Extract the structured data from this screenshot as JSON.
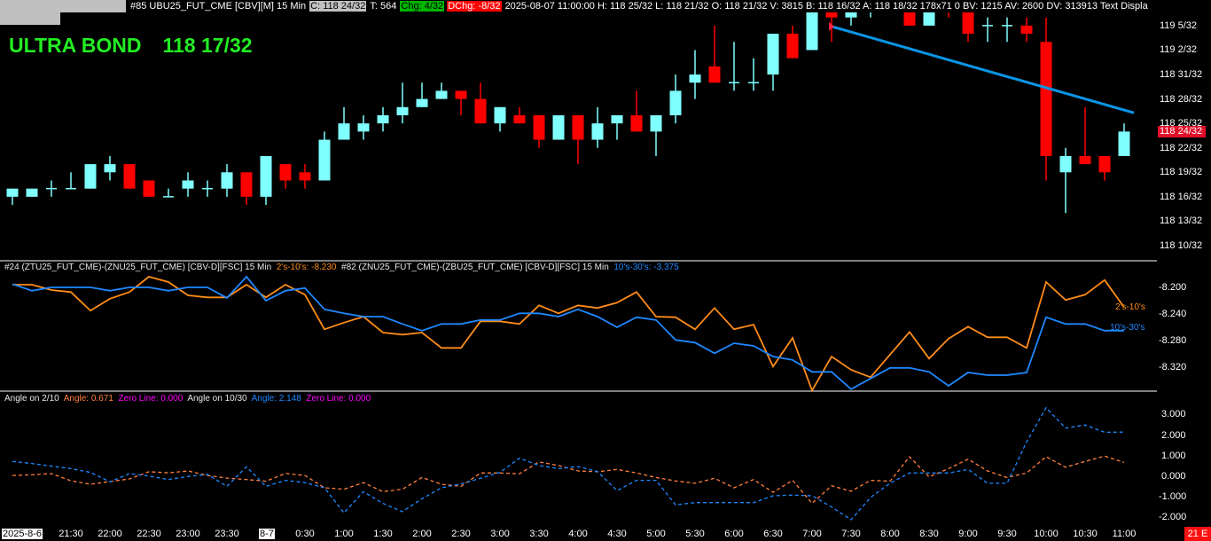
{
  "top_bar": {
    "symbol": "#85 UBU25_FUT_CME [CBV][M]  15 Min",
    "close": "C: 118 24/32",
    "trades": "T: 564",
    "change": "Chg: 4/32",
    "daily_change": "DChg: -8/32",
    "details": "2025-08-07 11:00:00 H: 118 25/32 L: 118 21/32 O: 118 21/32 V: 3815 B: 118 16/32 A: 118 18/32 178x71 0 BV: 1215 AV: 2600 DV: 313913 Text Displa"
  },
  "title": {
    "name": "ULTRA BOND",
    "price": "118 17/32"
  },
  "spread_header": {
    "study1": "#24 (ZTU25_FUT_CME)-(ZNU25_FUT_CME) [CBV-D][FSC]  15 Min",
    "value1": "2's-10's: -8.230",
    "study2": "#82 (ZNU25_FUT_CME)-(ZBU25_FUT_CME) [CBV-D][FSC]  15 Min",
    "value2": "10's-30's: -3.375"
  },
  "angle_header": {
    "label1": "Angle on 2/10",
    "angle1": "Angle: 0.671",
    "zero1": "Zero Line: 0.000",
    "label2": "Angle on 10/30",
    "angle2": "Angle: 2.148",
    "zero2": "Zero Line: 0.000"
  },
  "current_price_label": "118 24/32",
  "end_box": "21 E",
  "colors": {
    "up": "#80ffff",
    "down": "#ff0000",
    "orange": "#ff8c1a",
    "blue": "#1e88ff",
    "trendline": "#0a96e6"
  },
  "chart_data": [
    {
      "type": "candlestick",
      "title": "UBU25_FUT_CME 15 Min",
      "units": "32nds above 118",
      "bar_times": [
        "20:45",
        "21:00",
        "21:15",
        "21:30",
        "21:45",
        "22:00",
        "22:15",
        "22:30",
        "22:45",
        "23:00",
        "23:15",
        "23:30",
        "23:45",
        "0:00",
        "0:15",
        "0:30",
        "0:45",
        "1:00",
        "1:15",
        "1:30",
        "1:45",
        "2:00",
        "2:15",
        "2:30",
        "2:45",
        "3:00",
        "3:15",
        "3:30",
        "3:45",
        "4:00",
        "4:15",
        "4:30",
        "4:45",
        "5:00",
        "5:15",
        "5:30",
        "5:45",
        "6:00",
        "6:15",
        "6:30",
        "6:45",
        "7:00",
        "7:15",
        "7:30",
        "7:45",
        "8:00",
        "8:15",
        "8:30",
        "8:45",
        "9:00",
        "9:15",
        "9:30",
        "9:45",
        "10:00",
        "10:15",
        "10:30",
        "10:45",
        "11:00"
      ],
      "ohlc": [
        [
          16,
          17,
          15,
          17
        ],
        [
          16,
          17,
          16,
          17
        ],
        [
          17,
          18,
          16,
          17
        ],
        [
          17,
          19,
          17,
          17
        ],
        [
          17,
          20,
          17,
          20
        ],
        [
          19,
          21,
          18,
          20
        ],
        [
          20,
          20,
          17,
          17
        ],
        [
          18,
          18,
          16,
          16
        ],
        [
          16,
          17,
          16,
          16
        ],
        [
          17,
          19,
          16,
          18
        ],
        [
          17,
          18,
          16,
          17
        ],
        [
          17,
          20,
          16,
          19
        ],
        [
          19,
          19,
          15,
          16
        ],
        [
          16,
          21,
          15,
          21
        ],
        [
          20,
          20,
          17,
          18
        ],
        [
          19,
          20,
          17,
          18
        ],
        [
          18,
          24,
          18,
          23
        ],
        [
          23,
          27,
          23,
          25
        ],
        [
          24,
          26,
          23,
          25
        ],
        [
          25,
          27,
          24,
          26
        ],
        [
          26,
          30,
          25,
          27
        ],
        [
          27,
          30,
          27,
          28
        ],
        [
          28,
          30,
          28,
          29
        ],
        [
          29,
          29,
          26,
          28
        ],
        [
          28,
          30,
          25,
          25
        ],
        [
          25,
          27,
          24,
          27
        ],
        [
          26,
          27,
          25,
          25
        ],
        [
          26,
          26,
          22,
          23
        ],
        [
          23,
          26,
          23,
          26
        ],
        [
          26,
          26,
          20,
          23
        ],
        [
          23,
          27,
          22,
          25
        ],
        [
          25,
          26,
          23,
          26
        ],
        [
          26,
          29,
          24,
          24
        ],
        [
          24,
          26,
          21,
          26
        ],
        [
          26,
          31,
          25,
          29
        ],
        [
          30,
          34,
          28,
          31
        ],
        [
          32,
          37,
          30,
          30
        ],
        [
          30,
          35,
          29,
          30
        ],
        [
          30,
          33,
          29,
          30
        ],
        [
          31,
          36,
          29,
          36
        ],
        [
          36,
          37,
          33,
          33
        ],
        [
          34,
          39,
          34,
          39
        ],
        [
          39,
          39,
          35,
          38
        ],
        [
          38,
          39,
          37,
          39
        ],
        [
          39,
          41,
          38,
          40
        ],
        [
          40,
          42,
          39,
          41
        ],
        [
          40,
          41,
          37,
          37
        ],
        [
          37,
          40,
          37,
          40
        ],
        [
          41,
          42,
          38,
          40
        ],
        [
          39,
          39,
          35,
          36
        ],
        [
          37,
          38,
          35,
          37
        ],
        [
          37,
          38,
          35,
          37
        ],
        [
          37,
          38,
          35,
          36
        ],
        [
          35,
          38,
          18,
          21
        ],
        [
          19,
          22,
          14,
          21
        ],
        [
          21,
          27,
          20,
          20
        ],
        [
          21,
          21,
          18,
          19
        ],
        [
          21,
          25,
          21,
          24
        ]
      ],
      "trendline": {
        "from_bar": 42,
        "from_value": 36.9,
        "to_bar": 57.5,
        "to_value": 26.3
      },
      "y_ticks": [
        {
          "value": 37,
          "label": "119 5/32"
        },
        {
          "value": 34,
          "label": "119 2/32"
        },
        {
          "value": 31,
          "label": "118 31/32"
        },
        {
          "value": 28,
          "label": "118 28/32"
        },
        {
          "value": 25,
          "label": "118 25/32"
        },
        {
          "value": 22,
          "label": "118 22/32"
        },
        {
          "value": 19,
          "label": "118 19/32"
        },
        {
          "value": 16,
          "label": "118 16/32"
        },
        {
          "value": 13,
          "label": "118 13/32"
        },
        {
          "value": 10,
          "label": "118 10/32"
        }
      ],
      "current_value": 24
    },
    {
      "type": "line",
      "title": "Yield spreads",
      "ylim": [
        -8.36,
        -8.17
      ],
      "y_ticks": [
        "-8.200",
        "-8.240",
        "-8.280",
        "-8.320"
      ],
      "y_tick_values": [
        -8.2,
        -8.24,
        -8.28,
        -8.32
      ],
      "series": [
        {
          "name": "2's-10's",
          "color": "#ff8c1a",
          "values": [
            -8.196,
            -8.196,
            -8.204,
            -8.207,
            -8.235,
            -8.217,
            -8.207,
            -8.184,
            -8.192,
            -8.212,
            -8.215,
            -8.215,
            -8.196,
            -8.215,
            -8.196,
            -8.211,
            -8.263,
            -8.253,
            -8.244,
            -8.268,
            -8.271,
            -8.268,
            -8.291,
            -8.291,
            -8.251,
            -8.251,
            -8.255,
            -8.227,
            -8.239,
            -8.227,
            -8.231,
            -8.223,
            -8.207,
            -8.244,
            -8.245,
            -8.263,
            -8.231,
            -8.263,
            -8.256,
            -8.319,
            -8.276,
            -8.355,
            -8.304,
            -8.324,
            -8.335,
            -8.301,
            -8.267,
            -8.307,
            -8.277,
            -8.259,
            -8.275,
            -8.275,
            -8.291,
            -8.192,
            -8.219,
            -8.211,
            -8.189,
            -8.23
          ]
        },
        {
          "name": "10's-30's",
          "color": "#1e88ff",
          "values": [
            -8.195,
            -8.205,
            -8.2,
            -8.2,
            -8.2,
            -8.205,
            -8.2,
            -8.2,
            -8.205,
            -8.2,
            -8.2,
            -8.216,
            -8.184,
            -8.22,
            -8.205,
            -8.201,
            -8.233,
            -8.239,
            -8.244,
            -8.244,
            -8.255,
            -8.265,
            -8.255,
            -8.255,
            -8.249,
            -8.249,
            -8.239,
            -8.239,
            -8.244,
            -8.233,
            -8.244,
            -8.26,
            -8.245,
            -8.249,
            -8.279,
            -8.283,
            -8.299,
            -8.284,
            -8.288,
            -8.304,
            -8.309,
            -8.327,
            -8.327,
            -8.353,
            -8.337,
            -8.321,
            -8.321,
            -8.327,
            -8.348,
            -8.328,
            -8.332,
            -8.332,
            -8.328,
            -8.245,
            -8.255,
            -8.255,
            -8.265,
            -8.265
          ]
        }
      ]
    },
    {
      "type": "line",
      "title": "Angles",
      "ylim": [
        -2.3,
        3.4
      ],
      "y_ticks": [
        "3.000",
        "2.000",
        "1.000",
        "0.000",
        "-1.000",
        "-2.000"
      ],
      "y_tick_values": [
        3,
        2,
        1,
        0,
        -1,
        -2
      ],
      "series": [
        {
          "name": "Angle on 2/10",
          "color": "#ff7f3f",
          "values": [
            0.04,
            0.07,
            0.13,
            -0.22,
            -0.39,
            -0.26,
            -0.13,
            0.22,
            0.17,
            0.26,
            0.04,
            -0.09,
            -0.16,
            -0.24,
            0.14,
            0.04,
            -0.56,
            -0.63,
            -0.31,
            -0.75,
            -0.63,
            -0.06,
            -0.39,
            -0.49,
            0.16,
            0.16,
            0.12,
            0.7,
            0.52,
            0.26,
            0.22,
            0.33,
            0.16,
            -0.06,
            -0.23,
            -0.34,
            -0.1,
            -0.56,
            -0.16,
            -0.78,
            -0.2,
            -1.32,
            -0.46,
            -0.73,
            -0.2,
            -0.24,
            0.95,
            -0.03,
            0.37,
            0.83,
            0.26,
            -0.06,
            0.16,
            0.95,
            0.44,
            0.72,
            0.98,
            0.671
          ]
        },
        {
          "name": "Angle on 10/30",
          "color": "#1e88ff",
          "values": [
            0.72,
            0.62,
            0.49,
            0.37,
            0.19,
            -0.27,
            0.13,
            0.01,
            -0.16,
            -0.01,
            0.09,
            -0.49,
            0.46,
            -0.49,
            -0.2,
            -0.31,
            -0.56,
            -1.78,
            -0.75,
            -1.32,
            -1.72,
            -1.09,
            -0.56,
            -0.37,
            -0.1,
            0.19,
            0.88,
            0.52,
            0.37,
            0.47,
            0.23,
            -0.7,
            -0.2,
            -0.2,
            -1.39,
            -1.28,
            -1.28,
            -1.28,
            -1.28,
            -0.95,
            -0.92,
            -0.95,
            -1.49,
            -2.11,
            -1.03,
            -0.34,
            0.16,
            0.16,
            0.16,
            0.33,
            -0.34,
            -0.34,
            1.67,
            3.33,
            2.34,
            2.49,
            2.14,
            2.148
          ]
        }
      ]
    }
  ],
  "time_axis": [
    {
      "bar": 0,
      "label": "2025-8-6",
      "date": true
    },
    {
      "bar": 3,
      "label": "21:30"
    },
    {
      "bar": 5,
      "label": "22:00"
    },
    {
      "bar": 7,
      "label": "22:30"
    },
    {
      "bar": 9,
      "label": "23:00"
    },
    {
      "bar": 11,
      "label": "23:30"
    },
    {
      "bar": 13,
      "label": "8-7",
      "date": true
    },
    {
      "bar": 15,
      "label": "0:30"
    },
    {
      "bar": 17,
      "label": "1:00"
    },
    {
      "bar": 19,
      "label": "1:30"
    },
    {
      "bar": 21,
      "label": "2:00"
    },
    {
      "bar": 23,
      "label": "2:30"
    },
    {
      "bar": 25,
      "label": "3:00"
    },
    {
      "bar": 27,
      "label": "3:30"
    },
    {
      "bar": 29,
      "label": "4:00"
    },
    {
      "bar": 31,
      "label": "4:30"
    },
    {
      "bar": 33,
      "label": "5:00"
    },
    {
      "bar": 35,
      "label": "5:30"
    },
    {
      "bar": 37,
      "label": "6:00"
    },
    {
      "bar": 39,
      "label": "6:30"
    },
    {
      "bar": 41,
      "label": "7:00"
    },
    {
      "bar": 43,
      "label": "7:30"
    },
    {
      "bar": 45,
      "label": "8:00"
    },
    {
      "bar": 47,
      "label": "8:30"
    },
    {
      "bar": 49,
      "label": "9:00"
    },
    {
      "bar": 51,
      "label": "9:30"
    },
    {
      "bar": 53,
      "label": "10:00"
    },
    {
      "bar": 55,
      "label": "10:30"
    },
    {
      "bar": 57,
      "label": "11:00"
    }
  ]
}
